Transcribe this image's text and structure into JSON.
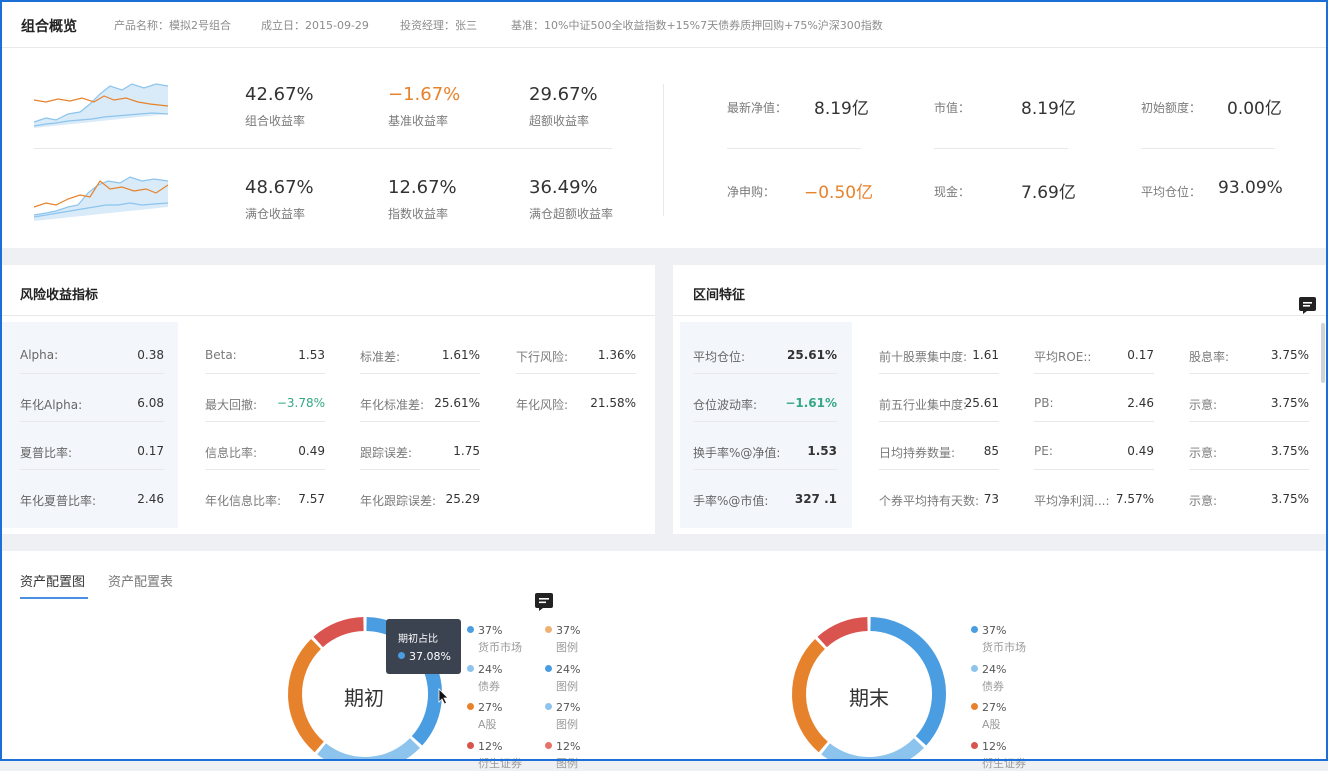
{
  "header": {
    "title": "组合概览",
    "product": "产品名称：模拟2号组合",
    "founded": "成立日：2015-09-29",
    "manager": "投资经理：张三",
    "benchmark": "基准：10%中证500全收益指数+15%7天债券质押回购+75%沪深300指数"
  },
  "returns": [
    {
      "value": "42.67%",
      "label": "组合收益率",
      "color": "#333333"
    },
    {
      "value": "−1.67%",
      "label": "基准收益率",
      "color": "#e7822c"
    },
    {
      "value": "29.67%",
      "label": "超额收益率",
      "color": "#333333"
    },
    {
      "value": "48.67%",
      "label": "满仓收益率",
      "color": "#333333"
    },
    {
      "value": "12.67%",
      "label": "指数收益率",
      "color": "#333333"
    },
    {
      "value": "36.49%",
      "label": "满仓超额收益率",
      "color": "#333333"
    }
  ],
  "summary": [
    {
      "label": "最新净值：",
      "value": "8.19亿"
    },
    {
      "label": "市值：",
      "value": "8.19亿"
    },
    {
      "label": "初始额度：",
      "value": "0.00亿"
    },
    {
      "label": "净申购：",
      "value": "−0.50亿"
    },
    {
      "label": "现金：",
      "value": "7.69亿"
    },
    {
      "label": "平均仓位：",
      "value": "93.09%"
    }
  ],
  "risk": {
    "title": "风险收益指标",
    "col1": [
      {
        "label": "Alpha:",
        "value": "0.38"
      },
      {
        "label": "年化Alpha:",
        "value": "6.08"
      },
      {
        "label": "夏普比率:",
        "value": "0.17"
      },
      {
        "label": "年化夏普比率:",
        "value": "2.46"
      }
    ],
    "col2": [
      {
        "label": "Beta:",
        "value": "1.53"
      },
      {
        "label": "最大回撤:",
        "value": "−3.78%"
      },
      {
        "label": "信息比率:",
        "value": "0.49"
      },
      {
        "label": "年化信息比率:",
        "value": "7.57"
      }
    ],
    "col3": [
      {
        "label": "标准差:",
        "value": "1.61%"
      },
      {
        "label": "年化标准差:",
        "value": "25.61%"
      },
      {
        "label": "跟踪误差:",
        "value": "1.75"
      },
      {
        "label": "年化跟踪误差:",
        "value": "25.29"
      }
    ],
    "col4": [
      {
        "label": "下行风险:",
        "value": "1.36%"
      },
      {
        "label": "年化风险:",
        "value": "21.58%"
      }
    ]
  },
  "interval": {
    "title": "区间特征",
    "col1": [
      {
        "label": "平均仓位:",
        "value": "25.61%"
      },
      {
        "label": "仓位波动率:",
        "value": "−1.61%"
      },
      {
        "label": "换手率%@净值:",
        "value": "1.53"
      },
      {
        "label": "手率%@市值:",
        "value": "327 .1"
      }
    ],
    "col2": [
      {
        "label": "前十股票集中度:",
        "value": "1.61"
      },
      {
        "label": "前五行业集中度:",
        "value": "25.61"
      },
      {
        "label": "日均持券数量:",
        "value": "85"
      },
      {
        "label": "个券平均持有天数:",
        "value": "73"
      }
    ],
    "col3": [
      {
        "label": "平均ROE::",
        "value": "0.17"
      },
      {
        "label": "PB:",
        "value": "2.46"
      },
      {
        "label": "PE:",
        "value": "0.49"
      },
      {
        "label": "平均净利润...:",
        "value": "7.57%"
      }
    ],
    "col4": [
      {
        "label": "股息率:",
        "value": "3.75%"
      },
      {
        "label": "示意:",
        "value": "3.75%"
      },
      {
        "label": "示意:",
        "value": "3.75%"
      },
      {
        "label": "示意:",
        "value": "3.75%"
      }
    ]
  },
  "asset": {
    "tabs": [
      "资产配置图",
      "资产配置表"
    ],
    "donut1_label": "期初",
    "donut2_label": "期末",
    "tooltip_title": "期初占比",
    "tooltip_value": "37.08%",
    "legend1_left": [
      {
        "pct": "37%",
        "name": "货币市场",
        "color": "#4a9de0"
      },
      {
        "pct": "24%",
        "name": "债券",
        "color": "#8cc4ee"
      },
      {
        "pct": "27%",
        "name": "A股",
        "color": "#e7822c"
      },
      {
        "pct": "12%",
        "name": "衍生证券",
        "color": "#d9534f"
      }
    ],
    "legend1_right": [
      {
        "pct": "37%",
        "name": "图例",
        "color": "#f0b071"
      },
      {
        "pct": "24%",
        "name": "图例",
        "color": "#4a9de0"
      },
      {
        "pct": "27%",
        "name": "图例",
        "color": "#8cc4ee"
      },
      {
        "pct": "12%",
        "name": "图例",
        "color": "#e6706a"
      }
    ],
    "legend2": [
      {
        "pct": "37%",
        "name": "货币市场",
        "color": "#4a9de0"
      },
      {
        "pct": "24%",
        "name": "债券",
        "color": "#8cc4ee"
      },
      {
        "pct": "27%",
        "name": "A股",
        "color": "#e7822c"
      },
      {
        "pct": "12%",
        "name": "衍生证券",
        "color": "#d9534f"
      }
    ]
  },
  "icons": [
    "comment-icon",
    "chat-icon",
    "cursor-icon"
  ]
}
